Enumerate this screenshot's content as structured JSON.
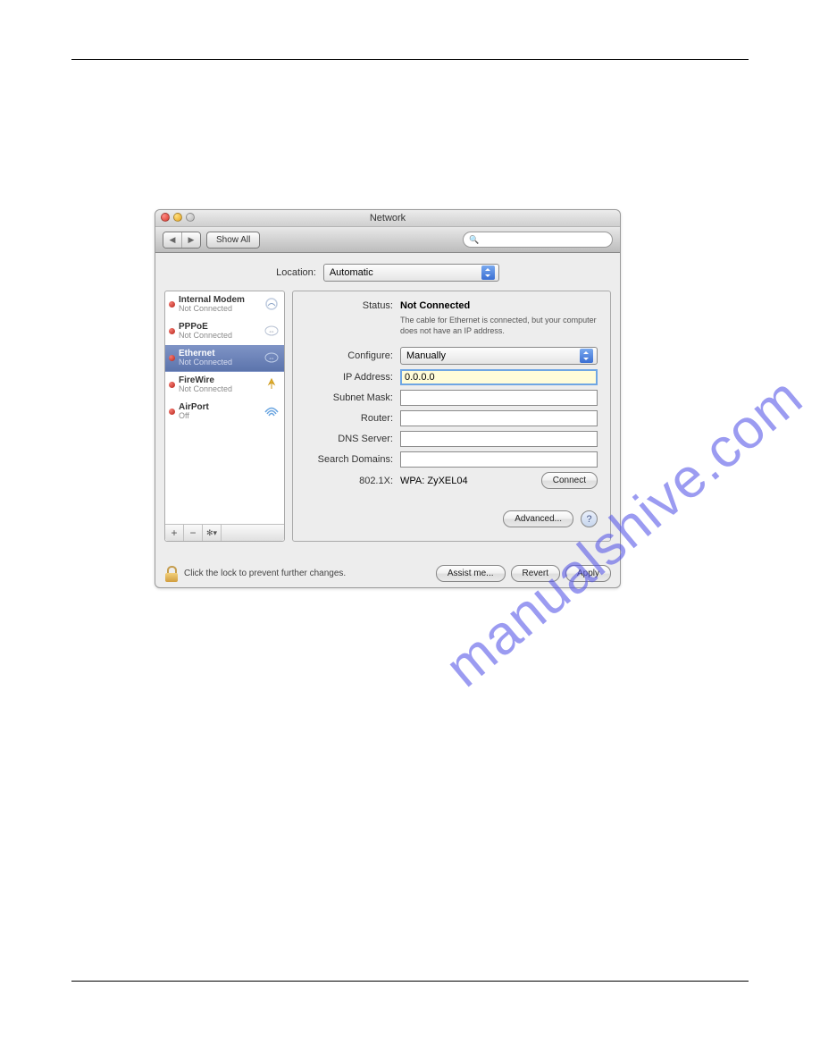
{
  "watermark": "manualshive.com",
  "window": {
    "title": "Network",
    "toolbar": {
      "show_all": "Show All",
      "search_placeholder": "Q"
    },
    "location": {
      "label": "Location:",
      "value": "Automatic"
    },
    "connections": [
      {
        "name": "Internal Modem",
        "status": "Not Connected",
        "selected": false,
        "icon": "phone"
      },
      {
        "name": "PPPoE",
        "status": "Not Connected",
        "selected": false,
        "icon": "arrows"
      },
      {
        "name": "Ethernet",
        "status": "Not Connected",
        "selected": true,
        "icon": "arrows"
      },
      {
        "name": "FireWire",
        "status": "Not Connected",
        "selected": false,
        "icon": "firewire"
      },
      {
        "name": "AirPort",
        "status": "Off",
        "selected": false,
        "icon": "wifi"
      }
    ],
    "sb_footer": {
      "add": "+",
      "remove": "−",
      "gear": "✻▾"
    },
    "main": {
      "status_label": "Status:",
      "status_value": "Not Connected",
      "status_desc": "The cable for Ethernet is connected, but your computer does not have an IP address.",
      "configure_label": "Configure:",
      "configure_value": "Manually",
      "ip_label": "IP Address:",
      "ip_value": "0.0.0.0",
      "subnet_label": "Subnet Mask:",
      "router_label": "Router:",
      "dns_label": "DNS Server:",
      "domains_label": "Search Domains:",
      "wpa_label": "802.1X:",
      "wpa_value": "WPA: ZyXEL04",
      "connect": "Connect",
      "advanced": "Advanced...",
      "help": "?"
    },
    "bottom": {
      "lock_text": "Click the lock to prevent further changes.",
      "assist": "Assist me...",
      "revert": "Revert",
      "apply": "Apply"
    }
  }
}
